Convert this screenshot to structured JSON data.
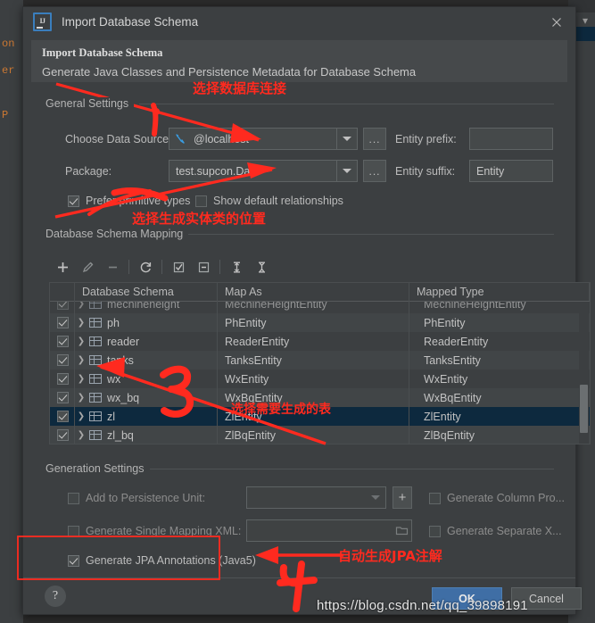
{
  "window": {
    "title": "Import Database Schema",
    "app_icon": "intellij-idea-icon",
    "close_icon": "close-icon"
  },
  "banner": {
    "title": "Import Database Schema",
    "subtitle": "Generate Java Classes and Persistence Metadata for Database Schema"
  },
  "general_settings": {
    "group_label": "General Settings",
    "data_source_label": "Choose Data Source:",
    "data_source_value": "@localhost",
    "data_source_icon": "database-link-icon",
    "data_source_browse": "...",
    "entity_prefix_label": "Entity prefix:",
    "entity_prefix_value": "",
    "entity_prefix_placeholder": "",
    "package_label": "Package:",
    "package_value": "test.supcon.Dao",
    "package_browse": "...",
    "entity_suffix_label": "Entity suffix:",
    "entity_suffix_value": "Entity",
    "prefer_primitive_label": "Prefer primitive types",
    "prefer_primitive_checked": true,
    "show_default_rel_label": "Show default relationships",
    "show_default_rel_checked": false
  },
  "schema_mapping": {
    "group_label": "Database Schema Mapping",
    "toolbar": [
      {
        "name": "add-icon",
        "glyph": "+",
        "enabled": true
      },
      {
        "name": "edit-pencil-icon",
        "glyph": "pencil",
        "enabled": false
      },
      {
        "name": "remove-icon",
        "glyph": "−",
        "enabled": false
      },
      {
        "name": "refresh-icon",
        "glyph": "refresh",
        "enabled": true
      },
      {
        "name": "select-all-icon",
        "glyph": "checkbox",
        "enabled": true
      },
      {
        "name": "deselect-all-icon",
        "glyph": "minus-box",
        "enabled": true
      },
      {
        "name": "expand-all-icon",
        "glyph": "expand",
        "enabled": true
      },
      {
        "name": "collapse-all-icon",
        "glyph": "collapse",
        "enabled": true
      }
    ],
    "columns": [
      "Database Schema",
      "Map As",
      "Mapped Type"
    ],
    "rows": [
      {
        "checked": true,
        "schema": "mechineheight",
        "map_as": "MechineHeightEntity",
        "mapped_type": "MechineHeightEntity",
        "selected": false,
        "clipped": true
      },
      {
        "checked": true,
        "schema": "ph",
        "map_as": "PhEntity",
        "mapped_type": "PhEntity",
        "selected": false,
        "clipped": false
      },
      {
        "checked": true,
        "schema": "reader",
        "map_as": "ReaderEntity",
        "mapped_type": "ReaderEntity",
        "selected": false,
        "clipped": false
      },
      {
        "checked": true,
        "schema": "tanks",
        "map_as": "TanksEntity",
        "mapped_type": "TanksEntity",
        "selected": false,
        "clipped": false
      },
      {
        "checked": true,
        "schema": "wx",
        "map_as": "WxEntity",
        "mapped_type": "WxEntity",
        "selected": false,
        "clipped": false
      },
      {
        "checked": true,
        "schema": "wx_bq",
        "map_as": "WxBqEntity",
        "mapped_type": "WxBqEntity",
        "selected": false,
        "clipped": false
      },
      {
        "checked": true,
        "schema": "zl",
        "map_as": "ZlEntity",
        "mapped_type": "ZlEntity",
        "selected": true,
        "clipped": false
      },
      {
        "checked": true,
        "schema": "zl_bq",
        "map_as": "ZlBqEntity",
        "mapped_type": "ZlBqEntity",
        "selected": false,
        "clipped": false
      }
    ]
  },
  "generation_settings": {
    "group_label": "Generation Settings",
    "add_persistence_unit_label": "Add to Persistence Unit:",
    "add_persistence_unit_checked": false,
    "persistence_unit_value": "",
    "add_unit_plus": "+",
    "generate_column_pro_label": "Generate Column Pro...",
    "generate_column_pro_checked": false,
    "single_mapping_xml_label": "Generate Single Mapping XML:",
    "single_mapping_xml_checked": false,
    "single_mapping_xml_value": "",
    "folder_icon": "folder-icon",
    "generate_separate_x_label": "Generate Separate X...",
    "generate_separate_x_checked": false,
    "jpa_annotations_label": "Generate JPA Annotations (Java5)",
    "jpa_annotations_checked": true
  },
  "footer": {
    "help_label": "?",
    "ok_label": "OK",
    "cancel_label": "Cancel"
  },
  "annotations": {
    "color": "#ff2a1f",
    "note_1": "选择数据库连接",
    "note_2": "选择生成实体类的位置",
    "note_3": "选择需要生成的表",
    "note_4": "自动生成JPA注解",
    "marker_3": "3",
    "marker_4": "4"
  },
  "watermark": {
    "text": "https://blog.csdn.net/qq_39898191"
  },
  "background": {
    "code_1": "on",
    "code_2": "er",
    "code_3": "P"
  }
}
